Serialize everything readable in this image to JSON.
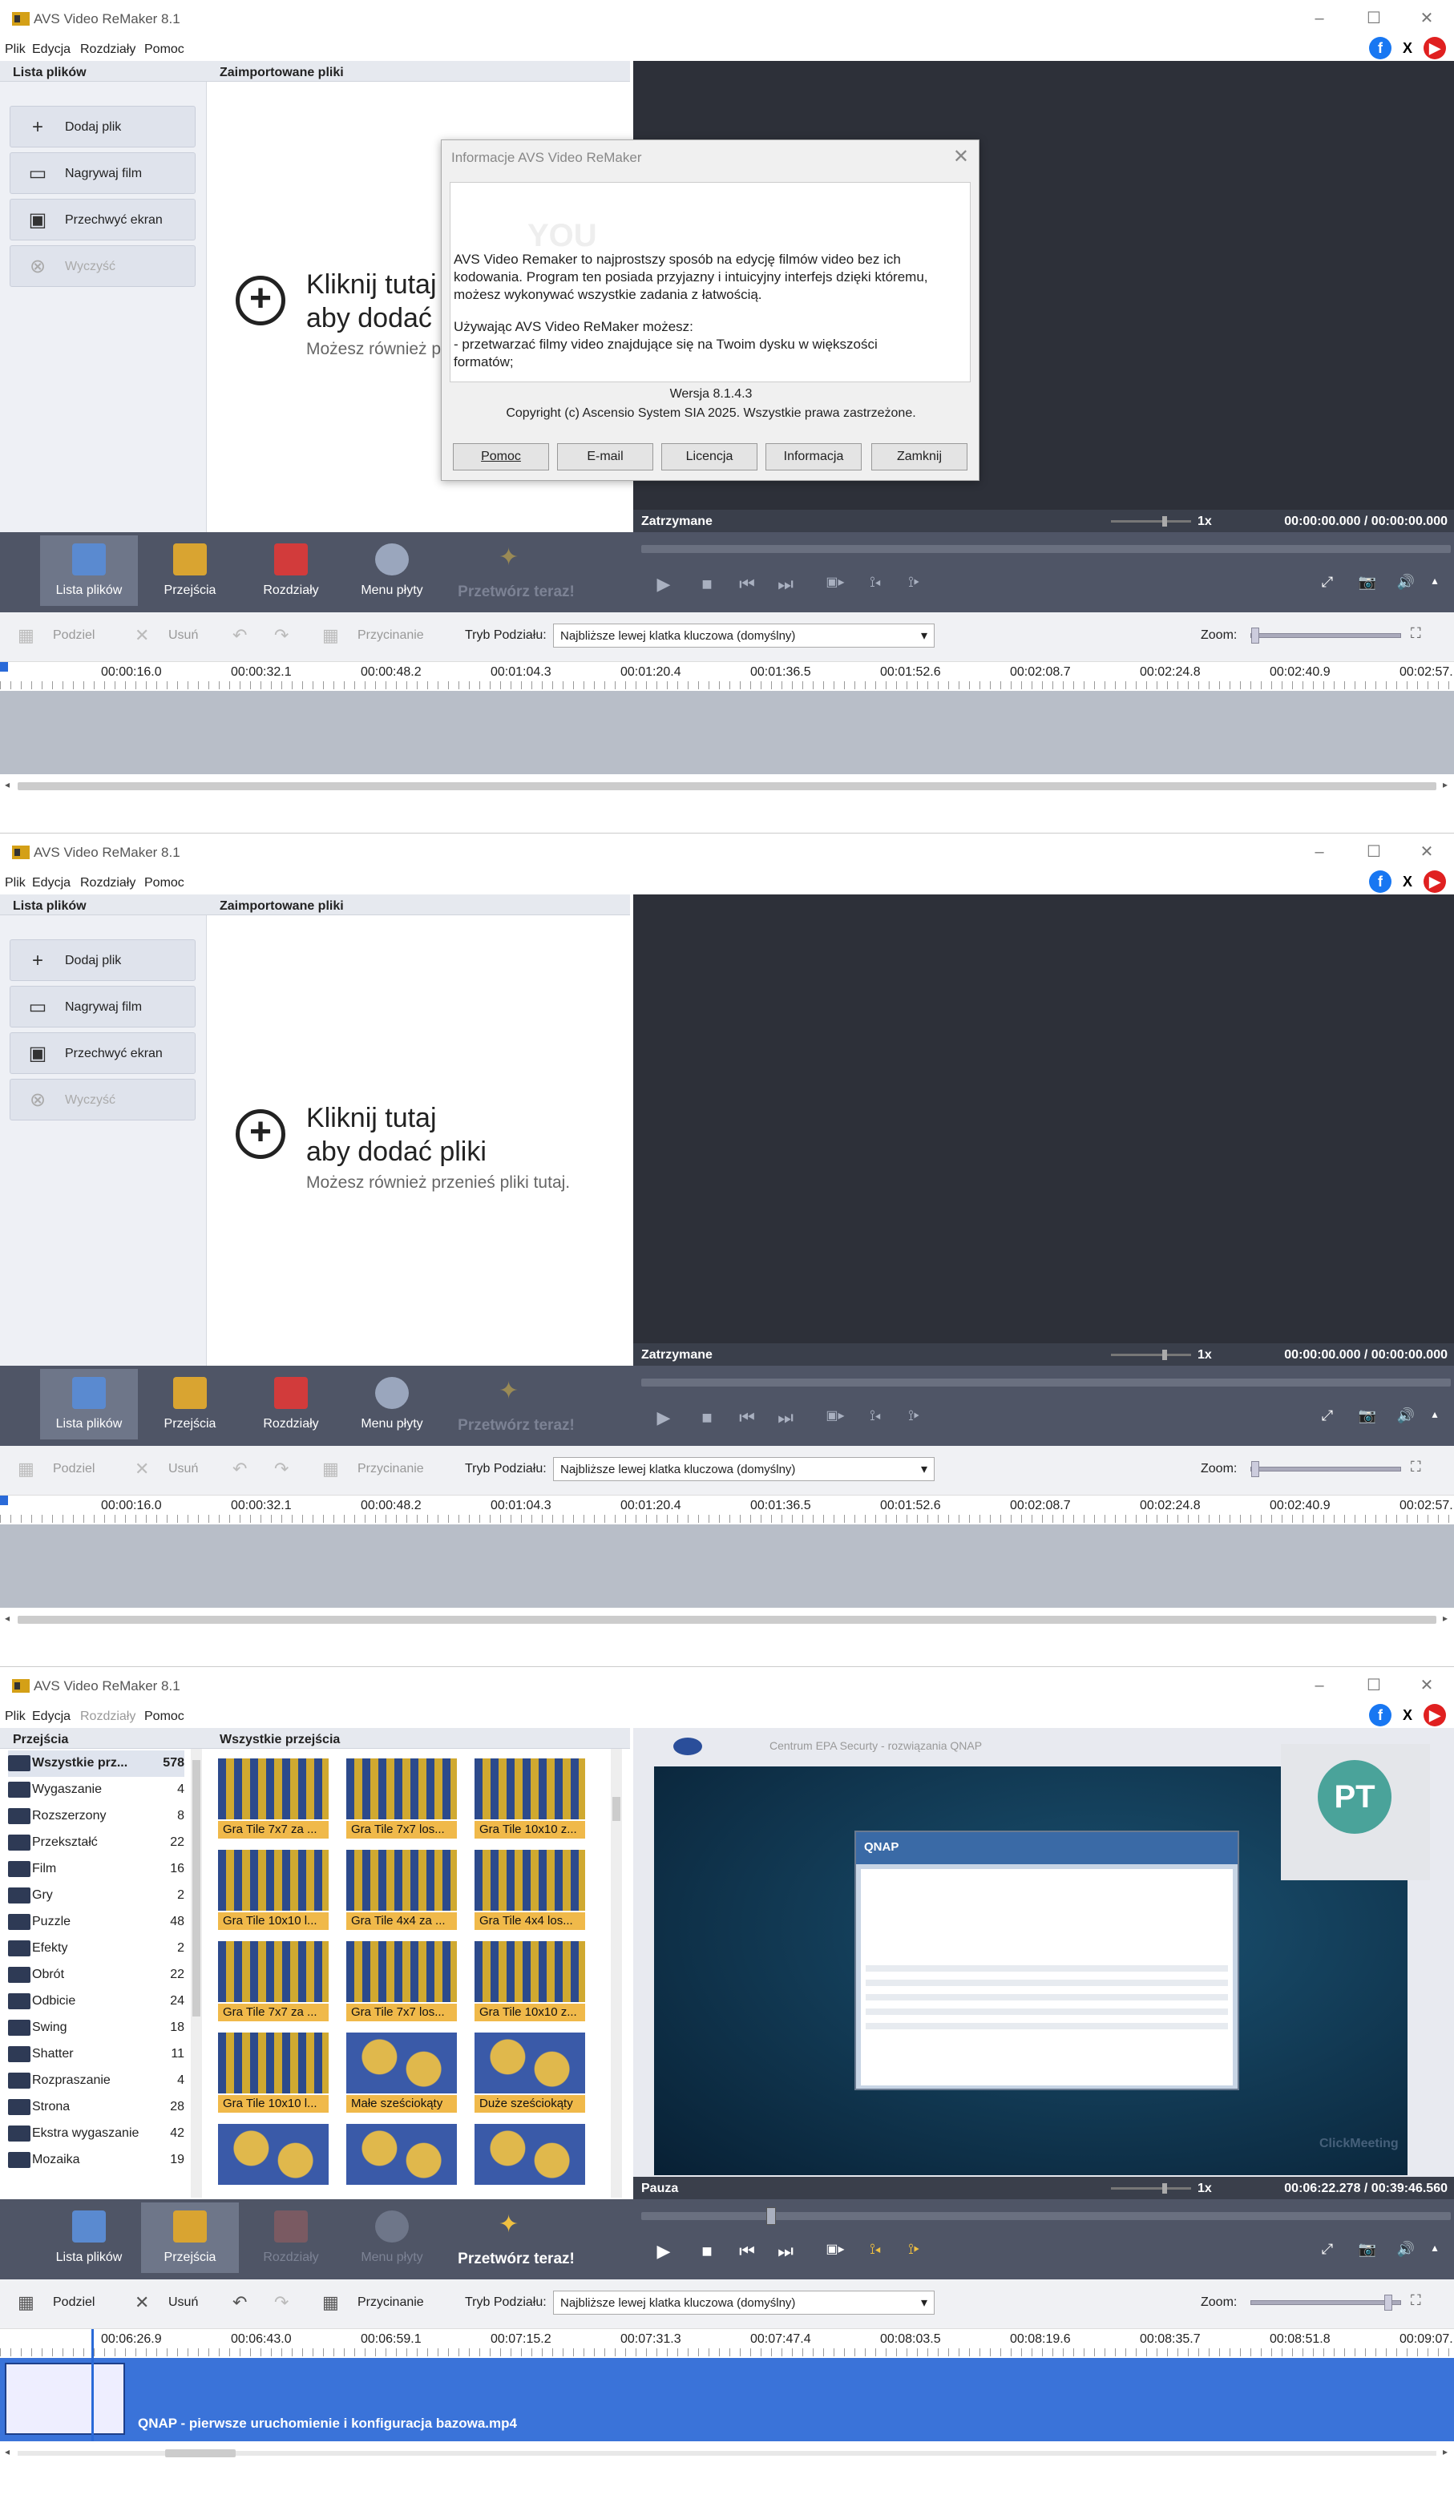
{
  "app": {
    "title": "AVS Video ReMaker 8.1",
    "window_controls": [
      "–",
      "☐",
      "✕"
    ],
    "menu": [
      "Plik",
      "Edycja",
      "Rozdziały",
      "Pomoc"
    ],
    "social": [
      "f",
      "X",
      "▶"
    ]
  },
  "left_buttons": [
    {
      "label": "Dodaj plik",
      "icon": "plus-icon",
      "glyph": "+"
    },
    {
      "label": "Nagrywaj film",
      "icon": "camera-icon",
      "glyph": "▭"
    },
    {
      "label": "Przechwyć ekran",
      "icon": "monitor-icon",
      "glyph": "▣"
    },
    {
      "label": "Wyczyść",
      "icon": "clear-icon",
      "glyph": "⊗"
    }
  ],
  "headers": {
    "files": "Lista plików",
    "imported": "Zaimportowane pliki",
    "transitions": "Przejścia",
    "all_transitions": "Wszystkie przejścia"
  },
  "drop_area": {
    "line1": "Kliknij tutaj",
    "line2": "aby dodać pliki",
    "line3": "Możesz również przenieś pliki tutaj.",
    "line1_clipped": "Kliknij tutaj",
    "line2_clipped": "aby dodać p",
    "line3_clipped": "Możesz również p"
  },
  "preview": {
    "status_stopped": "Zatrzymane",
    "status_paused": "Pauza",
    "speed": "1x",
    "time_empty": "00:00:00.000 / 00:00:00.000",
    "time_playing": "00:06:22.278 / 00:39:46.560"
  },
  "toolbar": {
    "items": [
      "Lista plików",
      "Przejścia",
      "Rozdziały",
      "Menu płyty",
      "Przetwórz teraz!"
    ],
    "playback": [
      "▶",
      "■",
      "⏮",
      "⏭",
      "▣▸",
      "⟟◂",
      "⟟▸"
    ],
    "right": [
      "⤢",
      "📷",
      "🔊",
      "▴"
    ]
  },
  "edit": {
    "split": "Podziel",
    "delete": "Usuń",
    "trim": "Przycinanie",
    "mode_label": "Tryb Podziału:",
    "mode_value": "Najbliższe lewej klatka kluczowa (domyślny)",
    "zoom_label": "Zoom:"
  },
  "ruler1": [
    "00:00:16.0",
    "00:00:32.1",
    "00:00:48.2",
    "00:01:04.3",
    "00:01:20.4",
    "00:01:36.5",
    "00:01:52.6",
    "00:02:08.7",
    "00:02:24.8",
    "00:02:40.9",
    "00:02:57."
  ],
  "ruler3": [
    "00:06:26.9",
    "00:06:43.0",
    "00:06:59.1",
    "00:07:15.2",
    "00:07:31.3",
    "00:07:47.4",
    "00:08:03.5",
    "00:08:19.6",
    "00:08:35.7",
    "00:08:51.8",
    "00:09:07."
  ],
  "dialog": {
    "title": "Informacje AVS Video ReMaker",
    "close": "✕",
    "watermark": "YOU",
    "p1": "AVS Video Remaker to najprostszy sposób na edycję filmów video bez ich",
    "p2": "kodowania. Program ten posiada przyjazny i intuicyjny interfejs dzięki któremu,",
    "p3": "możesz wykonywać wszystkie zadania z łatwością.",
    "p4": "Używając AVS Video ReMaker możesz:",
    "p5": "- przetwarzać filmy video znajdujące się na Twoim dysku w większości",
    "p6": "formatów;",
    "version": "Wersja 8.1.4.3",
    "copyright": "Copyright (c) Ascensio System SIA 2025. Wszystkie prawa zastrzeżone.",
    "buttons": [
      "Pomoc",
      "E-mail",
      "Licencja",
      "Informacja",
      "Zamknij"
    ]
  },
  "categories": [
    {
      "name": "Wszystkie prz...",
      "count": "578"
    },
    {
      "name": "Wygaszanie",
      "count": "4"
    },
    {
      "name": "Rozszerzony",
      "count": "8"
    },
    {
      "name": "Przekształć",
      "count": "22"
    },
    {
      "name": "Film",
      "count": "16"
    },
    {
      "name": "Gry",
      "count": "2"
    },
    {
      "name": "Puzzle",
      "count": "48"
    },
    {
      "name": "Efekty",
      "count": "2"
    },
    {
      "name": "Obrót",
      "count": "22"
    },
    {
      "name": "Odbicie",
      "count": "24"
    },
    {
      "name": "Swing",
      "count": "18"
    },
    {
      "name": "Shatter",
      "count": "11"
    },
    {
      "name": "Rozpraszanie",
      "count": "4"
    },
    {
      "name": "Strona",
      "count": "28"
    },
    {
      "name": "Ekstra wygaszanie",
      "count": "42"
    },
    {
      "name": "Mozaika",
      "count": "19"
    }
  ],
  "transitions": [
    "Gra Tile 7x7 za ...",
    "Gra Tile 7x7 los...",
    "Gra Tile 10x10 z...",
    "Gra Tile 10x10 l...",
    "Gra Tile 4x4 za ...",
    "Gra Tile 4x4 los...",
    "Gra Tile 7x7 za ...",
    "Gra Tile 7x7 los...",
    "Gra Tile 10x10 z...",
    "Gra Tile 10x10 l...",
    "Małe sześciokąty",
    "Duże sześciokąty",
    "",
    "",
    ""
  ],
  "video": {
    "header": "Centrum EPA Securty - rozwiązania QNAP",
    "app_name": "QNAP",
    "participant_initials": "PT",
    "watermark": "ClickMeeting"
  },
  "clip": {
    "name": "QNAP - pierwsze uruchomienie i konfiguracja bazowa.mp4"
  },
  "colors": {
    "toolbar_bg": "#4f5566",
    "preview_bg": "#2d3039",
    "clip_blue": "#3a73d9",
    "accent_gold": "#f0b94a"
  }
}
